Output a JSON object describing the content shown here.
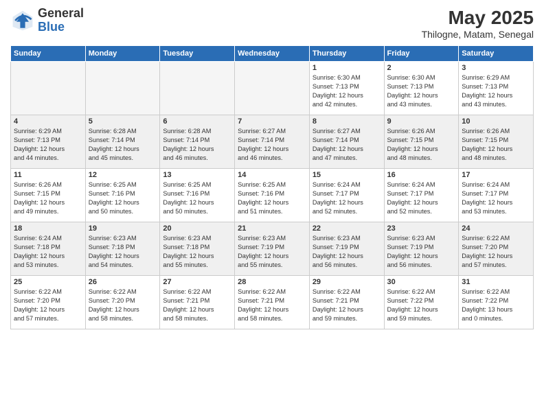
{
  "header": {
    "logo_general": "General",
    "logo_blue": "Blue",
    "month": "May 2025",
    "location": "Thilogne, Matam, Senegal"
  },
  "days_of_week": [
    "Sunday",
    "Monday",
    "Tuesday",
    "Wednesday",
    "Thursday",
    "Friday",
    "Saturday"
  ],
  "weeks": [
    [
      {
        "day": "",
        "info": "",
        "empty": true
      },
      {
        "day": "",
        "info": "",
        "empty": true
      },
      {
        "day": "",
        "info": "",
        "empty": true
      },
      {
        "day": "",
        "info": "",
        "empty": true
      },
      {
        "day": "1",
        "info": "Sunrise: 6:30 AM\nSunset: 7:13 PM\nDaylight: 12 hours\nand 42 minutes.",
        "empty": false
      },
      {
        "day": "2",
        "info": "Sunrise: 6:30 AM\nSunset: 7:13 PM\nDaylight: 12 hours\nand 43 minutes.",
        "empty": false
      },
      {
        "day": "3",
        "info": "Sunrise: 6:29 AM\nSunset: 7:13 PM\nDaylight: 12 hours\nand 43 minutes.",
        "empty": false
      }
    ],
    [
      {
        "day": "4",
        "info": "Sunrise: 6:29 AM\nSunset: 7:13 PM\nDaylight: 12 hours\nand 44 minutes.",
        "empty": false
      },
      {
        "day": "5",
        "info": "Sunrise: 6:28 AM\nSunset: 7:14 PM\nDaylight: 12 hours\nand 45 minutes.",
        "empty": false
      },
      {
        "day": "6",
        "info": "Sunrise: 6:28 AM\nSunset: 7:14 PM\nDaylight: 12 hours\nand 46 minutes.",
        "empty": false
      },
      {
        "day": "7",
        "info": "Sunrise: 6:27 AM\nSunset: 7:14 PM\nDaylight: 12 hours\nand 46 minutes.",
        "empty": false
      },
      {
        "day": "8",
        "info": "Sunrise: 6:27 AM\nSunset: 7:14 PM\nDaylight: 12 hours\nand 47 minutes.",
        "empty": false
      },
      {
        "day": "9",
        "info": "Sunrise: 6:26 AM\nSunset: 7:15 PM\nDaylight: 12 hours\nand 48 minutes.",
        "empty": false
      },
      {
        "day": "10",
        "info": "Sunrise: 6:26 AM\nSunset: 7:15 PM\nDaylight: 12 hours\nand 48 minutes.",
        "empty": false
      }
    ],
    [
      {
        "day": "11",
        "info": "Sunrise: 6:26 AM\nSunset: 7:15 PM\nDaylight: 12 hours\nand 49 minutes.",
        "empty": false
      },
      {
        "day": "12",
        "info": "Sunrise: 6:25 AM\nSunset: 7:16 PM\nDaylight: 12 hours\nand 50 minutes.",
        "empty": false
      },
      {
        "day": "13",
        "info": "Sunrise: 6:25 AM\nSunset: 7:16 PM\nDaylight: 12 hours\nand 50 minutes.",
        "empty": false
      },
      {
        "day": "14",
        "info": "Sunrise: 6:25 AM\nSunset: 7:16 PM\nDaylight: 12 hours\nand 51 minutes.",
        "empty": false
      },
      {
        "day": "15",
        "info": "Sunrise: 6:24 AM\nSunset: 7:17 PM\nDaylight: 12 hours\nand 52 minutes.",
        "empty": false
      },
      {
        "day": "16",
        "info": "Sunrise: 6:24 AM\nSunset: 7:17 PM\nDaylight: 12 hours\nand 52 minutes.",
        "empty": false
      },
      {
        "day": "17",
        "info": "Sunrise: 6:24 AM\nSunset: 7:17 PM\nDaylight: 12 hours\nand 53 minutes.",
        "empty": false
      }
    ],
    [
      {
        "day": "18",
        "info": "Sunrise: 6:24 AM\nSunset: 7:18 PM\nDaylight: 12 hours\nand 53 minutes.",
        "empty": false
      },
      {
        "day": "19",
        "info": "Sunrise: 6:23 AM\nSunset: 7:18 PM\nDaylight: 12 hours\nand 54 minutes.",
        "empty": false
      },
      {
        "day": "20",
        "info": "Sunrise: 6:23 AM\nSunset: 7:18 PM\nDaylight: 12 hours\nand 55 minutes.",
        "empty": false
      },
      {
        "day": "21",
        "info": "Sunrise: 6:23 AM\nSunset: 7:19 PM\nDaylight: 12 hours\nand 55 minutes.",
        "empty": false
      },
      {
        "day": "22",
        "info": "Sunrise: 6:23 AM\nSunset: 7:19 PM\nDaylight: 12 hours\nand 56 minutes.",
        "empty": false
      },
      {
        "day": "23",
        "info": "Sunrise: 6:23 AM\nSunset: 7:19 PM\nDaylight: 12 hours\nand 56 minutes.",
        "empty": false
      },
      {
        "day": "24",
        "info": "Sunrise: 6:22 AM\nSunset: 7:20 PM\nDaylight: 12 hours\nand 57 minutes.",
        "empty": false
      }
    ],
    [
      {
        "day": "25",
        "info": "Sunrise: 6:22 AM\nSunset: 7:20 PM\nDaylight: 12 hours\nand 57 minutes.",
        "empty": false
      },
      {
        "day": "26",
        "info": "Sunrise: 6:22 AM\nSunset: 7:20 PM\nDaylight: 12 hours\nand 58 minutes.",
        "empty": false
      },
      {
        "day": "27",
        "info": "Sunrise: 6:22 AM\nSunset: 7:21 PM\nDaylight: 12 hours\nand 58 minutes.",
        "empty": false
      },
      {
        "day": "28",
        "info": "Sunrise: 6:22 AM\nSunset: 7:21 PM\nDaylight: 12 hours\nand 58 minutes.",
        "empty": false
      },
      {
        "day": "29",
        "info": "Sunrise: 6:22 AM\nSunset: 7:21 PM\nDaylight: 12 hours\nand 59 minutes.",
        "empty": false
      },
      {
        "day": "30",
        "info": "Sunrise: 6:22 AM\nSunset: 7:22 PM\nDaylight: 12 hours\nand 59 minutes.",
        "empty": false
      },
      {
        "day": "31",
        "info": "Sunrise: 6:22 AM\nSunset: 7:22 PM\nDaylight: 13 hours\nand 0 minutes.",
        "empty": false
      }
    ]
  ]
}
